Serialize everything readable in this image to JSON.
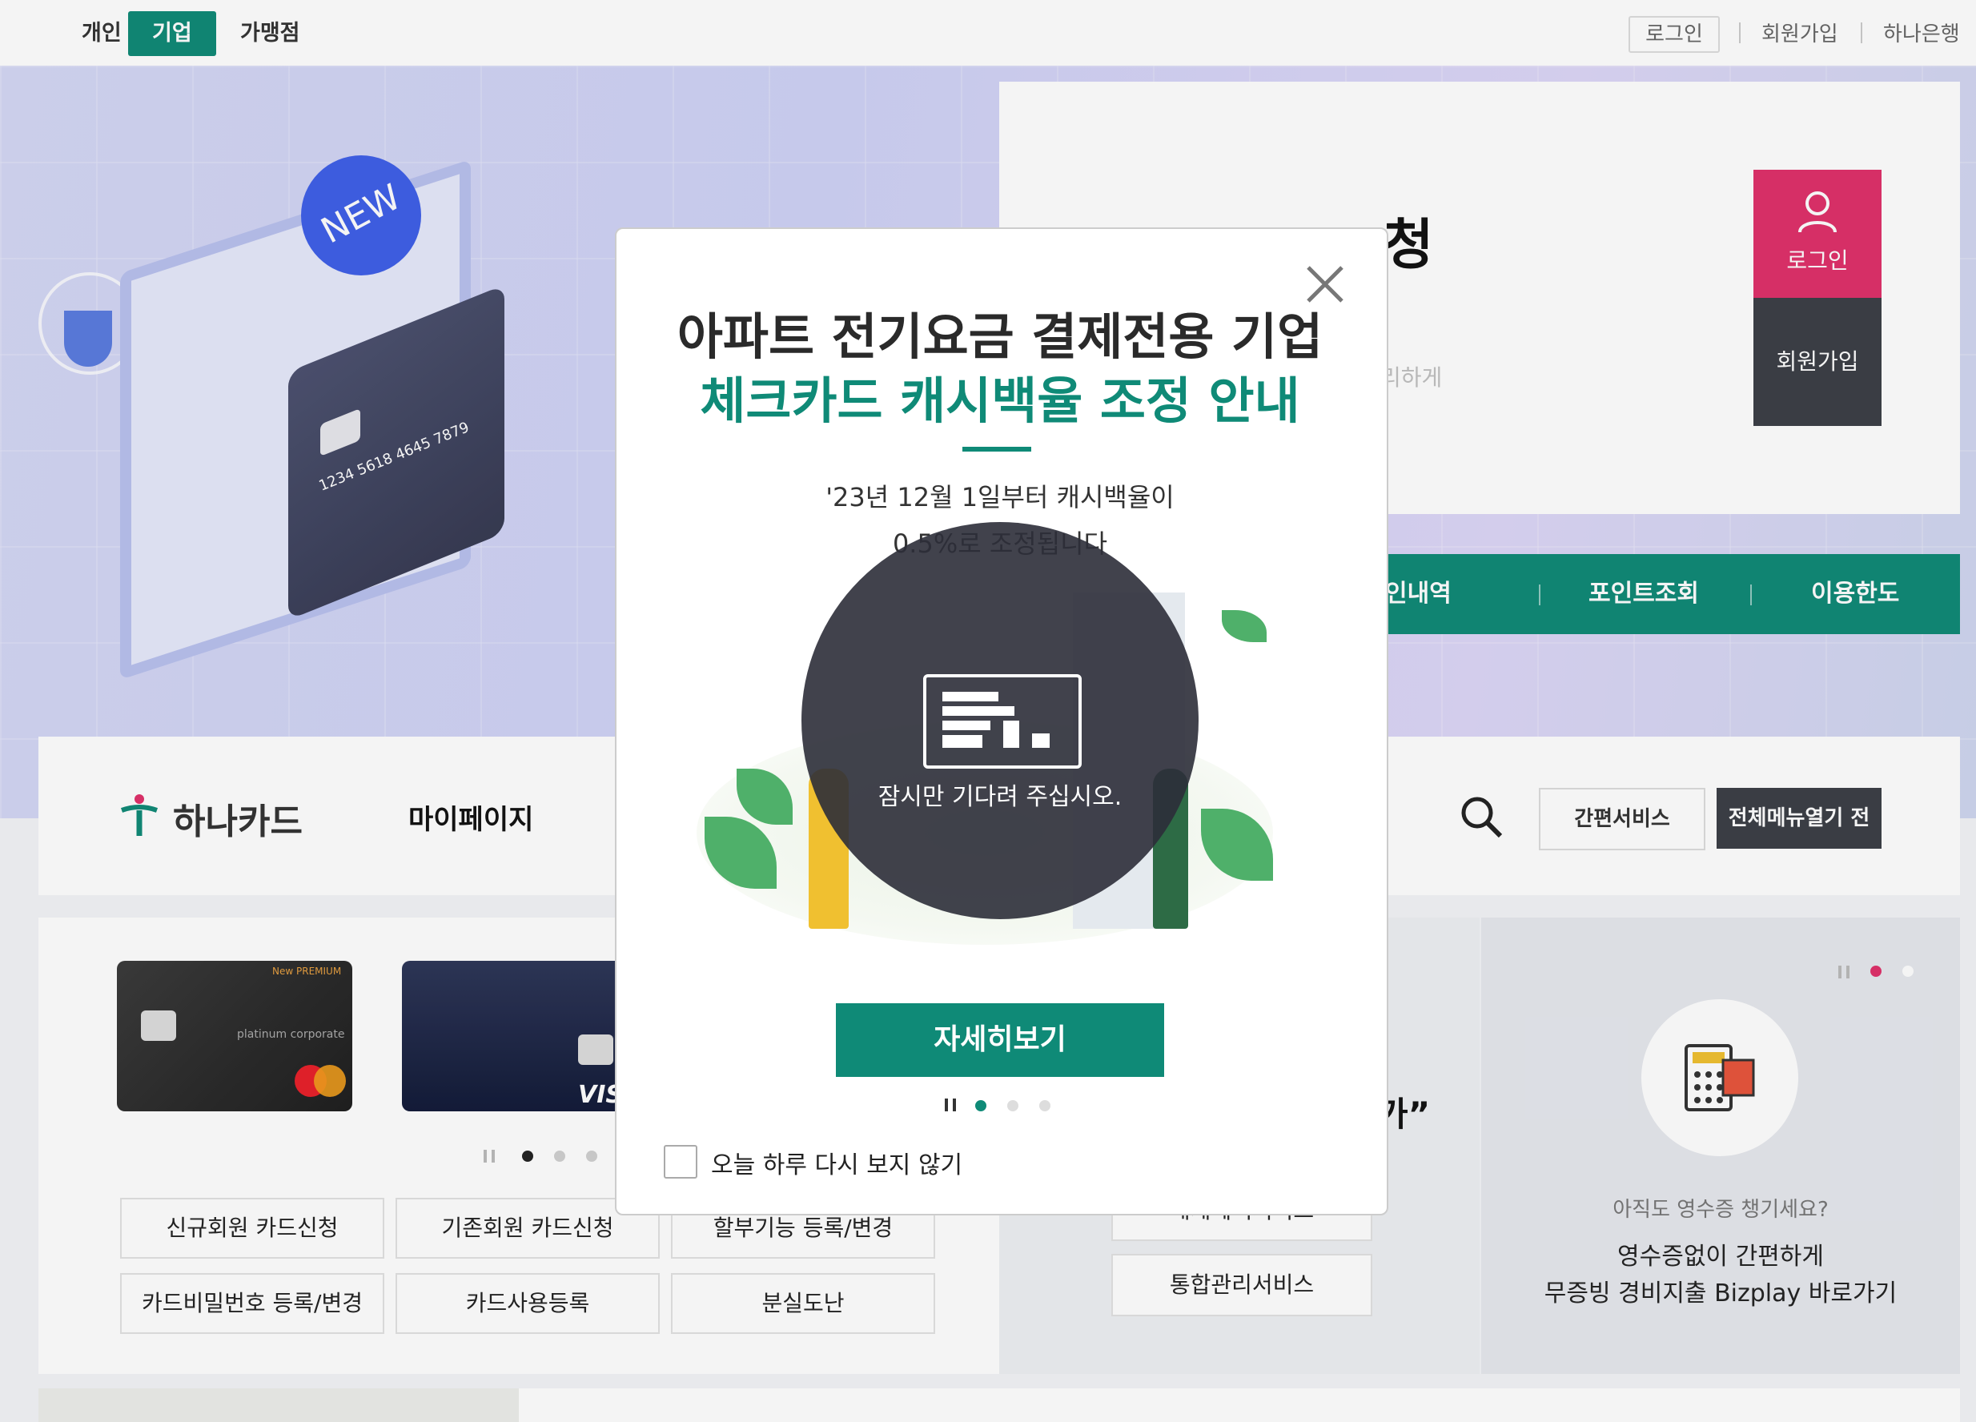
{
  "topbar": {
    "tabs": [
      {
        "label": "개인"
      },
      {
        "label": "기업"
      },
      {
        "label": "가맹점"
      }
    ],
    "active_tab": "기업",
    "links": {
      "login": "로그인",
      "join": "회원가입",
      "bank": "하나은행"
    }
  },
  "hero": {
    "badge": "NEW",
    "card_number": "1234 5618 4645 7879",
    "title_fragment": "청",
    "subtitle_fragment": "리하게",
    "side_login": "로그인",
    "side_join": "회원가입",
    "quick_menu": [
      "인내역",
      "포인트조회",
      "이용한도"
    ]
  },
  "nav": {
    "logo_text": "하나카드",
    "mypage": "마이페이지",
    "easy_service": "간편서비스",
    "all_menu": "전체메뉴열기 전"
  },
  "cards": {
    "card1_badge": "New PREMIUM",
    "card1_name": "platinum corporate",
    "card2_brand": "VISA"
  },
  "services": {
    "row1": [
      "신규회원 카드신청",
      "기존회원 카드신청",
      "할부기능 등록/변경"
    ],
    "row2": [
      "카드비밀번호 등록/변경",
      "카드사용등록",
      "분실도난"
    ],
    "right_partial": "세제혜택서비스",
    "right_integrated": "통합관리서비스",
    "quote_fragment": "가”"
  },
  "receipt": {
    "question": "아직도 영수증 챙기세요?",
    "line1": "영수증없이 간편하게",
    "line2": "무증빙 경비지출 Bizplay 바로가기"
  },
  "popup": {
    "title_line1": "아파트 전기요금 결제전용 기업",
    "title_line2": "체크카드 캐시백율 조정 안내",
    "body_line1": "'23년 12월 1일부터 캐시백율이",
    "body_line2": "0.5%로 조정됩니다",
    "loading_text": "잠시만 기다려 주십시오.",
    "detail_button": "자세히보기",
    "dont_show_today": "오늘 하루 다시 보지 않기"
  },
  "colors": {
    "brand_green": "#0f8a77",
    "login_pink": "#e0306a",
    "dark": "#3b3f46"
  }
}
